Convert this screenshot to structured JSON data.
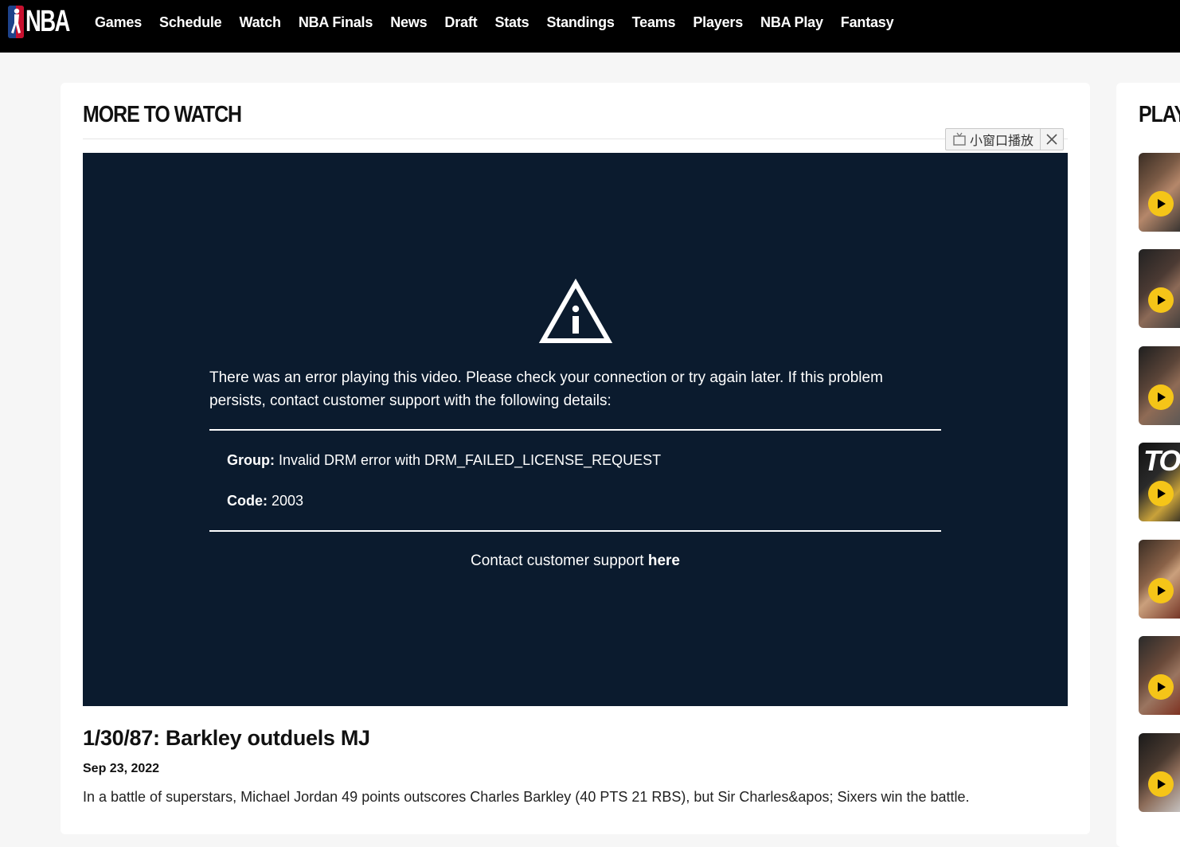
{
  "header": {
    "logo_text": "NBA",
    "nav": [
      "Games",
      "Schedule",
      "Watch",
      "NBA Finals",
      "News",
      "Draft",
      "Stats",
      "Standings",
      "Teams",
      "Players",
      "NBA Play",
      "Fantasy"
    ]
  },
  "main": {
    "section_title": "MORE TO WATCH",
    "pip_label": "小窗口播放",
    "player": {
      "error_message": "There was an error playing this video. Please check your connection or try again later. If this problem persists, contact customer support with the following details:",
      "group_label": "Group:",
      "group_value": "Invalid DRM error with DRM_FAILED_LICENSE_REQUEST",
      "code_label": "Code:",
      "code_value": "2003",
      "support_text": "Contact customer support",
      "support_link": "here"
    },
    "video": {
      "title": "1/30/87: Barkley outduels MJ",
      "date": "Sep 23, 2022",
      "description": "In a battle of superstars, Michael Jordan 49 points outscores Charles Barkley (40 PTS 21 RBS), but Sir Charles&apos; Sixers win the battle."
    }
  },
  "sidebar": {
    "title": "PLAY",
    "thumb_text": "TOP"
  },
  "colors": {
    "header_bg": "#000000",
    "player_bg": "#0b1b2e",
    "play_badge": "#f5c518"
  }
}
